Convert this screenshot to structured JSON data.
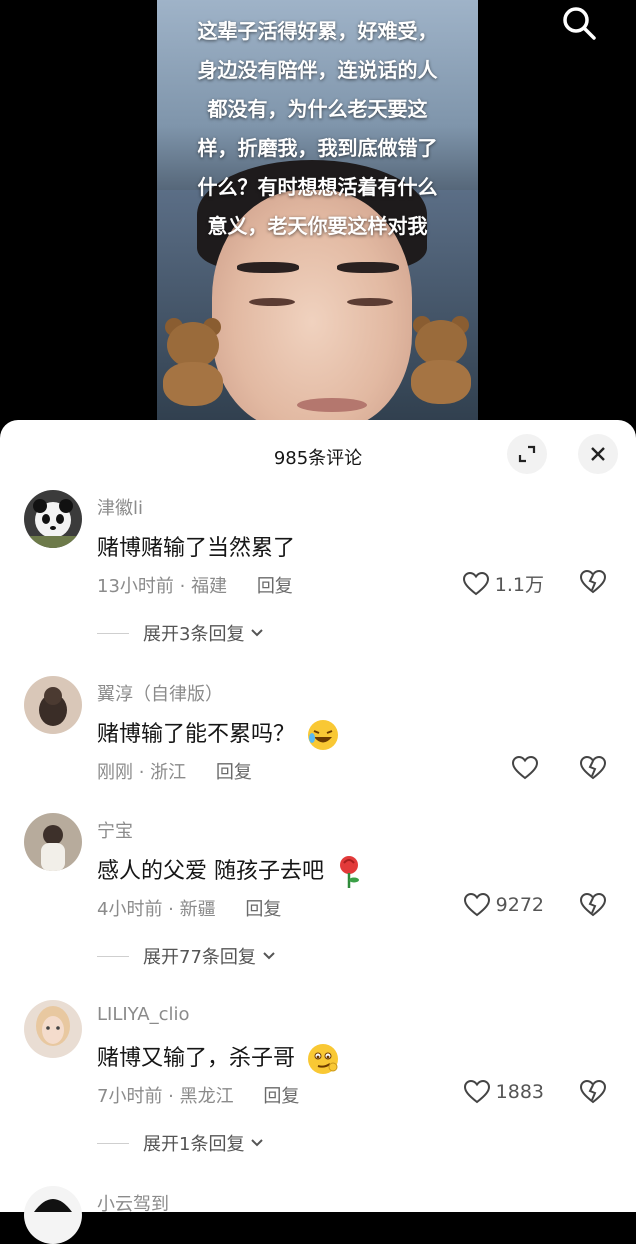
{
  "video": {
    "caption_lines": [
      "这辈子活得好累，好难受，",
      "身边没有陪伴，连说话的人",
      "都没有，为什么老天要这",
      "样，折磨我，我到底做错了",
      "什么？有时想想活着有什么",
      "意义，老天你要这样对我"
    ]
  },
  "sheet": {
    "title": "985条评论"
  },
  "comments": [
    {
      "username": "津徽li",
      "text": "赌博赌输了当然累了",
      "time": "13小时前",
      "location": "福建",
      "reply_label": "回复",
      "likes": "1.1万",
      "expand": "展开3条回复"
    },
    {
      "username": "翼淳（自律版）",
      "text": "赌博输了能不累吗？",
      "time": "刚刚",
      "location": "浙江",
      "reply_label": "回复",
      "likes": "",
      "expand": ""
    },
    {
      "username": "宁宝",
      "text": "感人的父爱 随孩子去吧",
      "time": "4小时前",
      "location": "新疆",
      "reply_label": "回复",
      "likes": "9272",
      "expand": "展开77条回复"
    },
    {
      "username": "LILIYA_clio",
      "text": "赌博又输了，杀子哥",
      "time": "7小时前",
      "location": "黑龙江",
      "reply_label": "回复",
      "likes": "1883",
      "expand": "展开1条回复"
    },
    {
      "username": "小云驾到"
    }
  ],
  "icons": [
    "search-icon",
    "expand-icon",
    "close-icon",
    "heart-icon",
    "broken-heart-icon",
    "chevron-down-icon"
  ]
}
